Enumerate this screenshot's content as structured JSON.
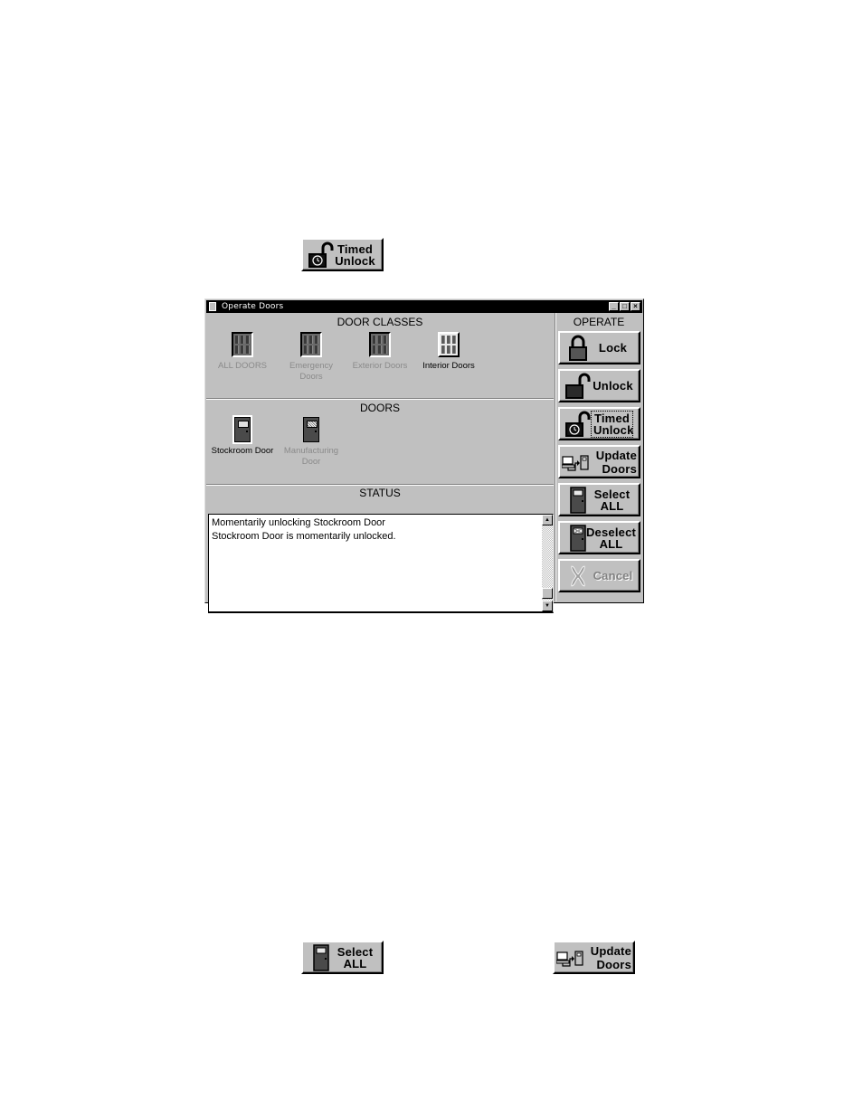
{
  "standalone_buttons": {
    "timed_unlock": {
      "line1": "Timed",
      "line2": "Unlock",
      "icon": "open-padlock-clock-icon"
    },
    "select_all": {
      "line1": "Select",
      "line2": "ALL",
      "icon": "door-icon"
    },
    "update_doors": {
      "line1": "Update",
      "line2": "Doors",
      "icon": "computer-to-door-icon"
    }
  },
  "window": {
    "title": "Operate Doors",
    "controls": {
      "minimize": "_",
      "maximize": "□",
      "close": "×"
    },
    "door_classes": {
      "heading": "DOOR CLASSES",
      "items": [
        {
          "label": "ALL DOORS",
          "selected": false
        },
        {
          "label": "Emergency Doors",
          "selected": false
        },
        {
          "label": "Exterior Doors",
          "selected": false
        },
        {
          "label": "Interior Doors",
          "selected": true
        }
      ]
    },
    "doors": {
      "heading": "DOORS",
      "items": [
        {
          "label": "Stockroom Door",
          "selected": true
        },
        {
          "label": "Manufacturing Door",
          "selected": false
        }
      ]
    },
    "status": {
      "heading": "STATUS",
      "lines": [
        "Momentarily unlocking Stockroom Door",
        "Stockroom Door is momentarily unlocked."
      ],
      "scroll_up": "▲",
      "scroll_down": "▼"
    },
    "operate": {
      "heading": "OPERATE",
      "buttons": {
        "lock": {
          "label": "Lock"
        },
        "unlock": {
          "label": "Unlock"
        },
        "timed_unlock": {
          "line1": "Timed",
          "line2": "Unlock",
          "focused": true
        },
        "update_doors": {
          "line1": "Update",
          "line2": "Doors"
        },
        "select_all": {
          "line1": "Select",
          "line2": "ALL"
        },
        "deselect_all": {
          "line1": "Deselect",
          "line2": "ALL"
        },
        "cancel": {
          "label": "Cancel",
          "disabled": true
        }
      }
    }
  }
}
